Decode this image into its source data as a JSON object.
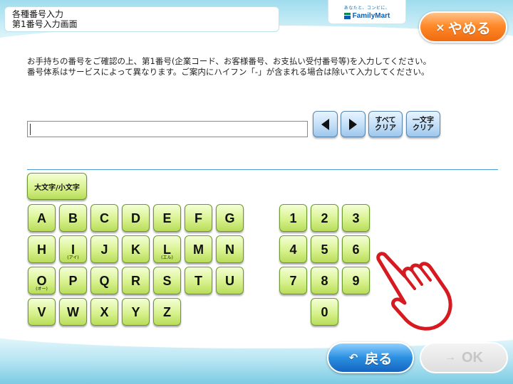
{
  "header": {
    "title_line1": "各種番号入力",
    "title_line2": "第1番号入力画面",
    "logo_tagline": "あなたと、コンビに、",
    "logo_name": "FamilyMart",
    "cancel_label": "やめる",
    "cancel_icon": "×"
  },
  "instructions": {
    "line1": "お手持ちの番号をご確認の上、第1番号(企業コード、お客様番号、お支払い受付番号等)を入力してください。",
    "line2": "番号体系はサービスによって異なります。ご案内にハイフン「-」が含まれる場合は除いて入力してください。"
  },
  "entry": {
    "value": ""
  },
  "controls": {
    "left_icon": "left-arrow-icon",
    "right_icon": "right-arrow-icon",
    "clear_all_line1": "すべて",
    "clear_all_line2": "クリア",
    "clear_one_line1": "一文字",
    "clear_one_line2": "クリア"
  },
  "keyboard": {
    "case_toggle_label": "大文字/小文字",
    "letters": {
      "A": "A",
      "B": "B",
      "C": "C",
      "D": "D",
      "E": "E",
      "F": "F",
      "G": "G",
      "H": "H",
      "I": "I",
      "J": "J",
      "K": "K",
      "L": "L",
      "M": "M",
      "N": "N",
      "O": "O",
      "P": "P",
      "Q": "Q",
      "R": "R",
      "S": "S",
      "T": "T",
      "U": "U",
      "V": "V",
      "W": "W",
      "X": "X",
      "Y": "Y",
      "Z": "Z"
    },
    "letter_hints": {
      "I": "(アイ)",
      "L": "(エル)",
      "O": "(オー)"
    },
    "digits": {
      "d0": "0",
      "d1": "1",
      "d2": "2",
      "d3": "3",
      "d4": "4",
      "d5": "5",
      "d6": "6",
      "d7": "7",
      "d8": "8",
      "d9": "9"
    }
  },
  "footer": {
    "back_label": "戻る",
    "back_icon": "↶",
    "ok_label": "OK",
    "ok_icon": "→"
  },
  "colors": {
    "cancel_orange": "#ff8a2a",
    "back_blue": "#2b8fe0",
    "key_green": "#d8f28e",
    "hand_red": "#d71920"
  }
}
